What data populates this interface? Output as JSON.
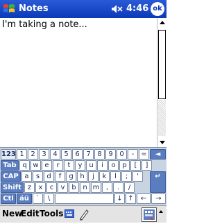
{
  "titlebar": {
    "app_title": "Notes",
    "time": "4:46",
    "ok_label": "ok"
  },
  "note": {
    "text": "I'm taking a note..."
  },
  "keyboard": {
    "rows": [
      [
        "123",
        "1",
        "2",
        "3",
        "4",
        "5",
        "6",
        "7",
        "8",
        "9",
        "0",
        "-",
        "=",
        "◄"
      ],
      [
        "Tab",
        "q",
        "w",
        "e",
        "r",
        "t",
        "y",
        "u",
        "i",
        "o",
        "p",
        "[",
        "]"
      ],
      [
        "CAP",
        "a",
        "s",
        "d",
        "f",
        "g",
        "h",
        "j",
        "k",
        "l",
        ";",
        "'"
      ],
      [
        "Shift",
        "z",
        "x",
        "c",
        "v",
        "b",
        "n",
        "m",
        ",",
        ".",
        "/",
        "↵"
      ],
      [
        "Ctl",
        "áü",
        "`",
        "\\",
        "↓",
        "↑",
        "←",
        "→"
      ]
    ]
  },
  "menubar": {
    "new": "New",
    "edit": "Edit",
    "tools": "Tools"
  },
  "icons": {
    "start": "windows-flag-icon",
    "volume": "speaker-muted-icon",
    "keyboard": "keyboard-icon",
    "pen": "pen-icon",
    "input_panel": "input-panel-icon"
  },
  "colors": {
    "title_bar": "#0b3ab8",
    "keyboard_bg": "#c9d4e3",
    "menubar_bg": "#e4e4e4"
  }
}
